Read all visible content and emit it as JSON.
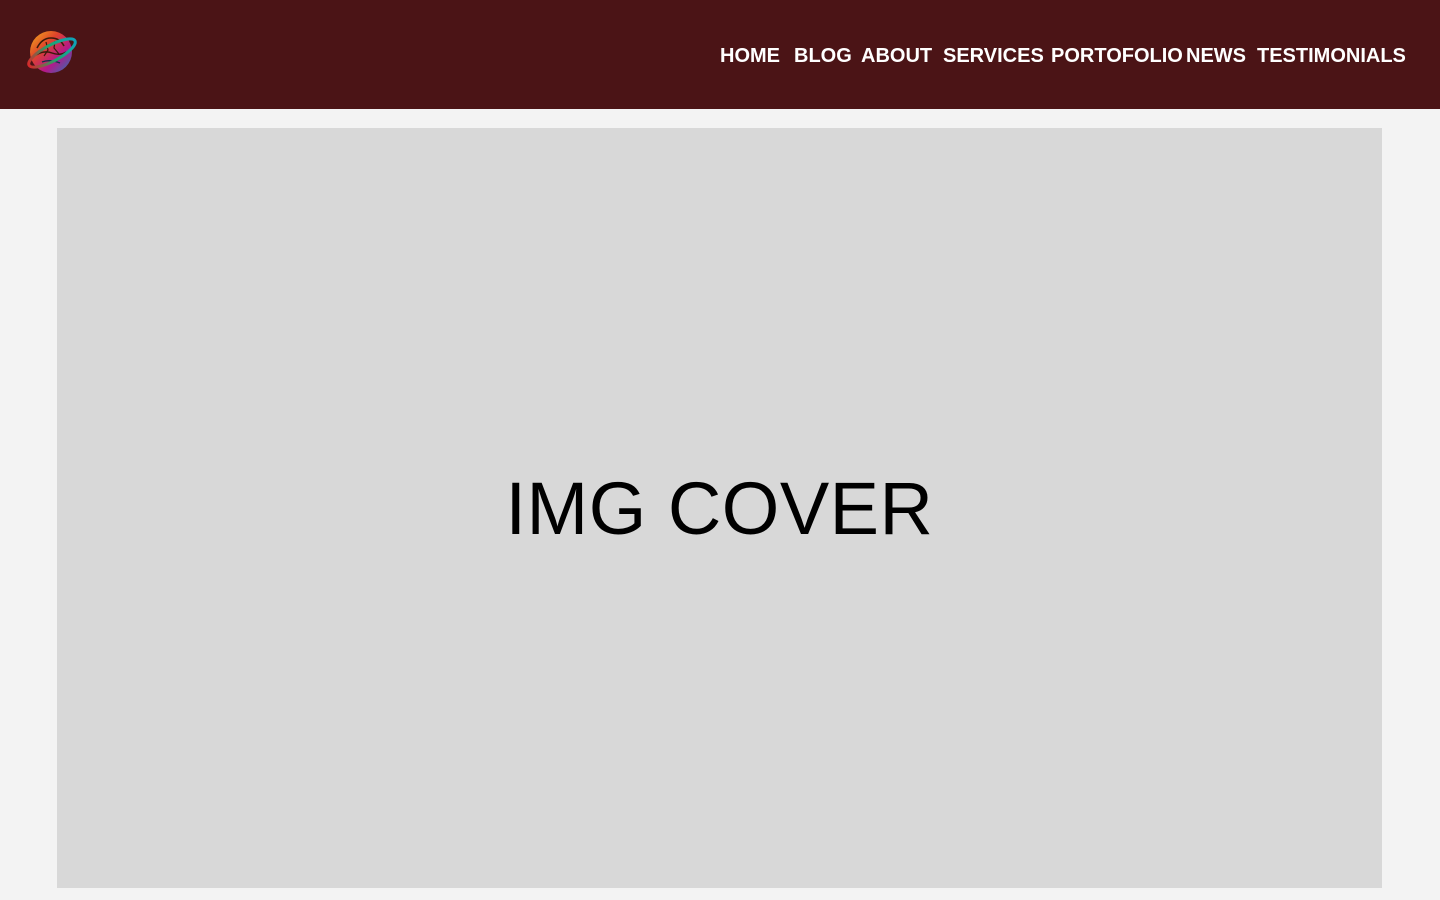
{
  "header": {
    "logo_icon": "globe-brain-logo-icon",
    "nav": {
      "home": "HOME",
      "blog": "BLOG",
      "about": "ABOUT",
      "services": "SERVICES",
      "portfolio": "PORTOFOLIO",
      "news": "NEWS",
      "testimonials": "TESTIMONIALS"
    }
  },
  "cover": {
    "label": "IMG COVER"
  },
  "colors": {
    "header_bg": "#4b1416",
    "page_bg": "#f3f3f3",
    "cover_bg": "#d8d8d8",
    "nav_text": "#ffffff"
  }
}
